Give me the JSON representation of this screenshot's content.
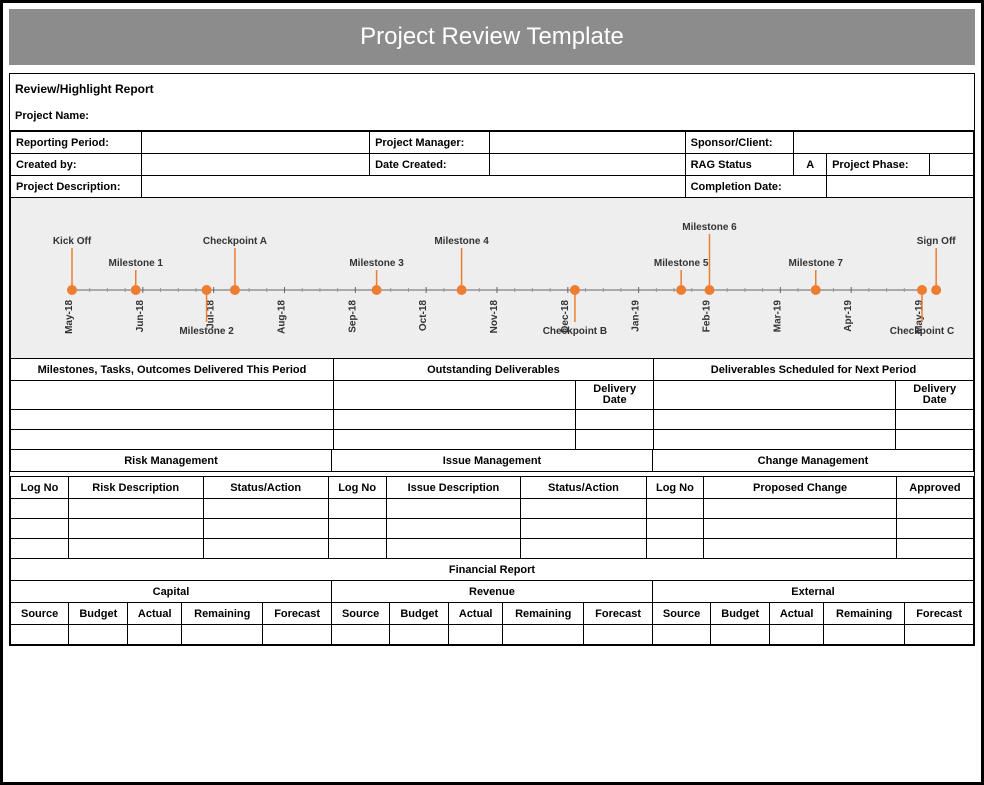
{
  "banner": "Project Review Template",
  "header": {
    "report_title": "Review/Highlight Report",
    "project_name_label": "Project Name:",
    "reporting_period_label": "Reporting Period:",
    "project_manager_label": "Project Manager:",
    "sponsor_client_label": "Sponsor/Client:",
    "created_by_label": "Created by:",
    "date_created_label": "Date Created:",
    "rag_status_label": "RAG Status",
    "rag_status_value": "A",
    "project_phase_label": "Project Phase:",
    "project_description_label": "Project Description:",
    "completion_date_label": "Completion Date:"
  },
  "chart_data": {
    "type": "timeline",
    "axis_ticks": [
      "May-18",
      "Jun-18",
      "Jul-18",
      "Aug-18",
      "Sep-18",
      "Oct-18",
      "Nov-18",
      "Dec-18",
      "Jan-19",
      "Feb-19",
      "Mar-19",
      "Apr-19",
      "May-19"
    ],
    "events_top": [
      {
        "label": "Kick Off",
        "x": 0.0,
        "stem": 42
      },
      {
        "label": "Milestone 1",
        "x": 0.9,
        "stem": 20
      },
      {
        "label": "Checkpoint A",
        "x": 2.3,
        "stem": 42
      },
      {
        "label": "Milestone 3",
        "x": 4.3,
        "stem": 20
      },
      {
        "label": "Milestone 4",
        "x": 5.5,
        "stem": 42
      },
      {
        "label": "Milestone 5",
        "x": 8.6,
        "stem": 20
      },
      {
        "label": "Milestone 6",
        "x": 9.0,
        "stem": 56
      },
      {
        "label": "Milestone 7",
        "x": 10.5,
        "stem": 20
      },
      {
        "label": "Sign Off",
        "x": 12.2,
        "stem": 42
      }
    ],
    "events_bottom": [
      {
        "label": "Milestone 2",
        "x": 1.9,
        "stem": 32
      },
      {
        "label": "Checkpoint B",
        "x": 7.1,
        "stem": 32
      },
      {
        "label": "Checkpoint C",
        "x": 12.0,
        "stem": 32
      }
    ]
  },
  "deliverables": {
    "col1_header": "Milestones, Tasks, Outcomes Delivered This Period",
    "col2_header": "Outstanding Deliverables",
    "col3_header": "Deliverables Scheduled for Next Period",
    "delivery_date_label": "Delivery Date"
  },
  "management": {
    "risk_header": "Risk Management",
    "issue_header": "Issue Management",
    "change_header": "Change Management",
    "log_no": "Log No",
    "risk_desc": "Risk Description",
    "status_action": "Status/Action",
    "issue_desc": "Issue Description",
    "proposed_change": "Proposed Change",
    "approved": "Approved"
  },
  "financial": {
    "title": "Financial Report",
    "capital": "Capital",
    "revenue": "Revenue",
    "external": "External",
    "source": "Source",
    "budget": "Budget",
    "actual": "Actual",
    "remaining": "Remaining",
    "forecast": "Forecast"
  }
}
